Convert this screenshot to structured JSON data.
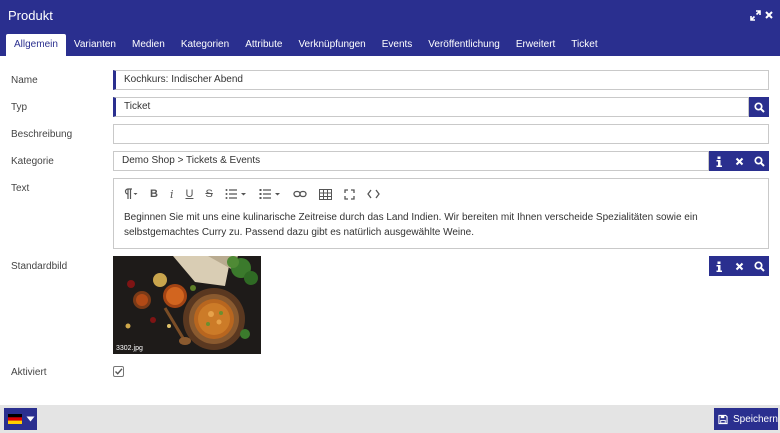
{
  "window": {
    "title": "Produkt"
  },
  "tabs": [
    {
      "label": "Allgemein",
      "active": true
    },
    {
      "label": "Varianten"
    },
    {
      "label": "Medien"
    },
    {
      "label": "Kategorien"
    },
    {
      "label": "Attribute"
    },
    {
      "label": "Verknüpfungen"
    },
    {
      "label": "Events"
    },
    {
      "label": "Veröffentlichung"
    },
    {
      "label": "Erweitert"
    },
    {
      "label": "Ticket"
    }
  ],
  "form": {
    "name": {
      "label": "Name",
      "value": "Kochkurs:  Indischer Abend"
    },
    "typ": {
      "label": "Typ",
      "value": "Ticket"
    },
    "beschreibung": {
      "label": "Beschreibung",
      "value": ""
    },
    "kategorie": {
      "label": "Kategorie",
      "value": "Demo Shop > Tickets & Events"
    },
    "text": {
      "label": "Text",
      "toolbar_icons": [
        "paragraph-icon",
        "bold-icon",
        "italic-icon",
        "underline-icon",
        "strikethrough-icon",
        "ordered-list-icon",
        "unordered-list-icon",
        "link-icon",
        "table-icon",
        "fullscreen-icon",
        "code-icon"
      ],
      "content": "Beginnen Sie mit uns eine kulinarische Zeitreise durch das Land Indien. Wir bereiten mit Ihnen verscheide Spezialitäten sowie ein selbstgemachtes Curry zu. Passend dazu gibt es natürlich ausgewählte Weine."
    },
    "standardbild": {
      "label": "Standardbild",
      "filename": "3302.jpg"
    },
    "aktiviert": {
      "label": "Aktiviert",
      "checked": true
    }
  },
  "footer": {
    "save_label": "Speichern",
    "language_icon": "flag-de-icon"
  },
  "colors": {
    "primary": "#2a2f8f",
    "footer_bg": "#e4e4e4",
    "border": "#c9c9c9"
  }
}
